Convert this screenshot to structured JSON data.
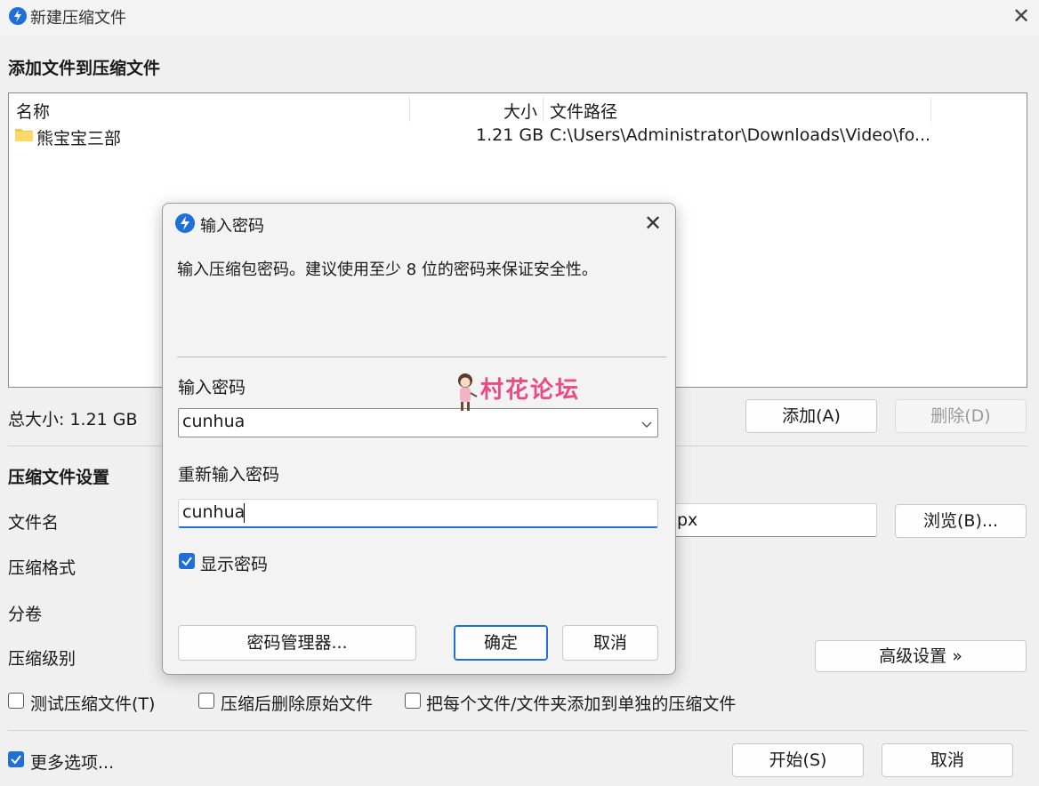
{
  "window": {
    "title": "新建压缩文件",
    "close_glyph": "✕"
  },
  "add_files": {
    "title": "添加文件到压缩文件",
    "columns": {
      "name": "名称",
      "size": "大小",
      "path": "文件路径"
    },
    "rows": [
      {
        "icon": "folder-icon",
        "name": "熊宝宝三部",
        "size": "1.21 GB",
        "path": "C:\\Users\\Administrator\\Downloads\\Video\\fo..."
      }
    ],
    "total_size": "总大小: 1.21 GB",
    "add_label": "添加(A)",
    "delete_label": "删除(D)"
  },
  "settings": {
    "title": "压缩文件设置",
    "filename_label": "文件名",
    "filename_value": "px",
    "browse_label": "浏览(B)...",
    "format_label": "压缩格式",
    "volume_label": "分卷",
    "level_label": "压缩级别",
    "advanced_label": "高级设置 »"
  },
  "options": {
    "test_label": "测试压缩文件(T)",
    "test_checked": false,
    "delete_source_label": "压缩后删除原始文件",
    "delete_source_checked": false,
    "each_separate_label": "把每个文件/文件夹添加到单独的压缩文件",
    "each_separate_checked": false,
    "more_label": "更多选项...",
    "more_checked": true
  },
  "footer": {
    "start_label": "开始(S)",
    "cancel_label": "取消"
  },
  "dialog": {
    "title": "输入密码",
    "close_glyph": "✕",
    "description": "输入压缩包密码。建议使用至少 8 位的密码来保证安全性。",
    "password_label": "输入密码",
    "password_value": "cunhua",
    "repassword_label": "重新输入密码",
    "repassword_value": "cunhua",
    "show_password_label": "显示密码",
    "show_password_checked": true,
    "manager_label": "密码管理器...",
    "ok_label": "确定",
    "cancel_label": "取消"
  },
  "watermark": {
    "text": "村花论坛"
  },
  "colors": {
    "accent": "#1f6fd8",
    "watermark": "#e94b83"
  }
}
